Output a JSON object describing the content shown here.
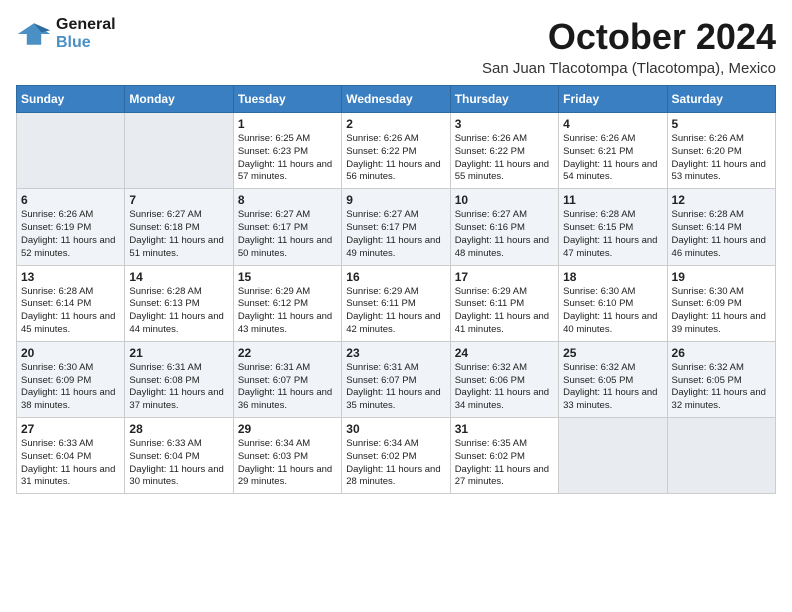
{
  "logo": {
    "line1": "General",
    "line2": "Blue"
  },
  "title": "October 2024",
  "subtitle": "San Juan Tlacotompa (Tlacotompa), Mexico",
  "days_of_week": [
    "Sunday",
    "Monday",
    "Tuesday",
    "Wednesday",
    "Thursday",
    "Friday",
    "Saturday"
  ],
  "weeks": [
    [
      {
        "day": "",
        "info": ""
      },
      {
        "day": "",
        "info": ""
      },
      {
        "day": "1",
        "info": "Sunrise: 6:25 AM\nSunset: 6:23 PM\nDaylight: 11 hours and 57 minutes."
      },
      {
        "day": "2",
        "info": "Sunrise: 6:26 AM\nSunset: 6:22 PM\nDaylight: 11 hours and 56 minutes."
      },
      {
        "day": "3",
        "info": "Sunrise: 6:26 AM\nSunset: 6:22 PM\nDaylight: 11 hours and 55 minutes."
      },
      {
        "day": "4",
        "info": "Sunrise: 6:26 AM\nSunset: 6:21 PM\nDaylight: 11 hours and 54 minutes."
      },
      {
        "day": "5",
        "info": "Sunrise: 6:26 AM\nSunset: 6:20 PM\nDaylight: 11 hours and 53 minutes."
      }
    ],
    [
      {
        "day": "6",
        "info": "Sunrise: 6:26 AM\nSunset: 6:19 PM\nDaylight: 11 hours and 52 minutes."
      },
      {
        "day": "7",
        "info": "Sunrise: 6:27 AM\nSunset: 6:18 PM\nDaylight: 11 hours and 51 minutes."
      },
      {
        "day": "8",
        "info": "Sunrise: 6:27 AM\nSunset: 6:17 PM\nDaylight: 11 hours and 50 minutes."
      },
      {
        "day": "9",
        "info": "Sunrise: 6:27 AM\nSunset: 6:17 PM\nDaylight: 11 hours and 49 minutes."
      },
      {
        "day": "10",
        "info": "Sunrise: 6:27 AM\nSunset: 6:16 PM\nDaylight: 11 hours and 48 minutes."
      },
      {
        "day": "11",
        "info": "Sunrise: 6:28 AM\nSunset: 6:15 PM\nDaylight: 11 hours and 47 minutes."
      },
      {
        "day": "12",
        "info": "Sunrise: 6:28 AM\nSunset: 6:14 PM\nDaylight: 11 hours and 46 minutes."
      }
    ],
    [
      {
        "day": "13",
        "info": "Sunrise: 6:28 AM\nSunset: 6:14 PM\nDaylight: 11 hours and 45 minutes."
      },
      {
        "day": "14",
        "info": "Sunrise: 6:28 AM\nSunset: 6:13 PM\nDaylight: 11 hours and 44 minutes."
      },
      {
        "day": "15",
        "info": "Sunrise: 6:29 AM\nSunset: 6:12 PM\nDaylight: 11 hours and 43 minutes."
      },
      {
        "day": "16",
        "info": "Sunrise: 6:29 AM\nSunset: 6:11 PM\nDaylight: 11 hours and 42 minutes."
      },
      {
        "day": "17",
        "info": "Sunrise: 6:29 AM\nSunset: 6:11 PM\nDaylight: 11 hours and 41 minutes."
      },
      {
        "day": "18",
        "info": "Sunrise: 6:30 AM\nSunset: 6:10 PM\nDaylight: 11 hours and 40 minutes."
      },
      {
        "day": "19",
        "info": "Sunrise: 6:30 AM\nSunset: 6:09 PM\nDaylight: 11 hours and 39 minutes."
      }
    ],
    [
      {
        "day": "20",
        "info": "Sunrise: 6:30 AM\nSunset: 6:09 PM\nDaylight: 11 hours and 38 minutes."
      },
      {
        "day": "21",
        "info": "Sunrise: 6:31 AM\nSunset: 6:08 PM\nDaylight: 11 hours and 37 minutes."
      },
      {
        "day": "22",
        "info": "Sunrise: 6:31 AM\nSunset: 6:07 PM\nDaylight: 11 hours and 36 minutes."
      },
      {
        "day": "23",
        "info": "Sunrise: 6:31 AM\nSunset: 6:07 PM\nDaylight: 11 hours and 35 minutes."
      },
      {
        "day": "24",
        "info": "Sunrise: 6:32 AM\nSunset: 6:06 PM\nDaylight: 11 hours and 34 minutes."
      },
      {
        "day": "25",
        "info": "Sunrise: 6:32 AM\nSunset: 6:05 PM\nDaylight: 11 hours and 33 minutes."
      },
      {
        "day": "26",
        "info": "Sunrise: 6:32 AM\nSunset: 6:05 PM\nDaylight: 11 hours and 32 minutes."
      }
    ],
    [
      {
        "day": "27",
        "info": "Sunrise: 6:33 AM\nSunset: 6:04 PM\nDaylight: 11 hours and 31 minutes."
      },
      {
        "day": "28",
        "info": "Sunrise: 6:33 AM\nSunset: 6:04 PM\nDaylight: 11 hours and 30 minutes."
      },
      {
        "day": "29",
        "info": "Sunrise: 6:34 AM\nSunset: 6:03 PM\nDaylight: 11 hours and 29 minutes."
      },
      {
        "day": "30",
        "info": "Sunrise: 6:34 AM\nSunset: 6:02 PM\nDaylight: 11 hours and 28 minutes."
      },
      {
        "day": "31",
        "info": "Sunrise: 6:35 AM\nSunset: 6:02 PM\nDaylight: 11 hours and 27 minutes."
      },
      {
        "day": "",
        "info": ""
      },
      {
        "day": "",
        "info": ""
      }
    ]
  ]
}
